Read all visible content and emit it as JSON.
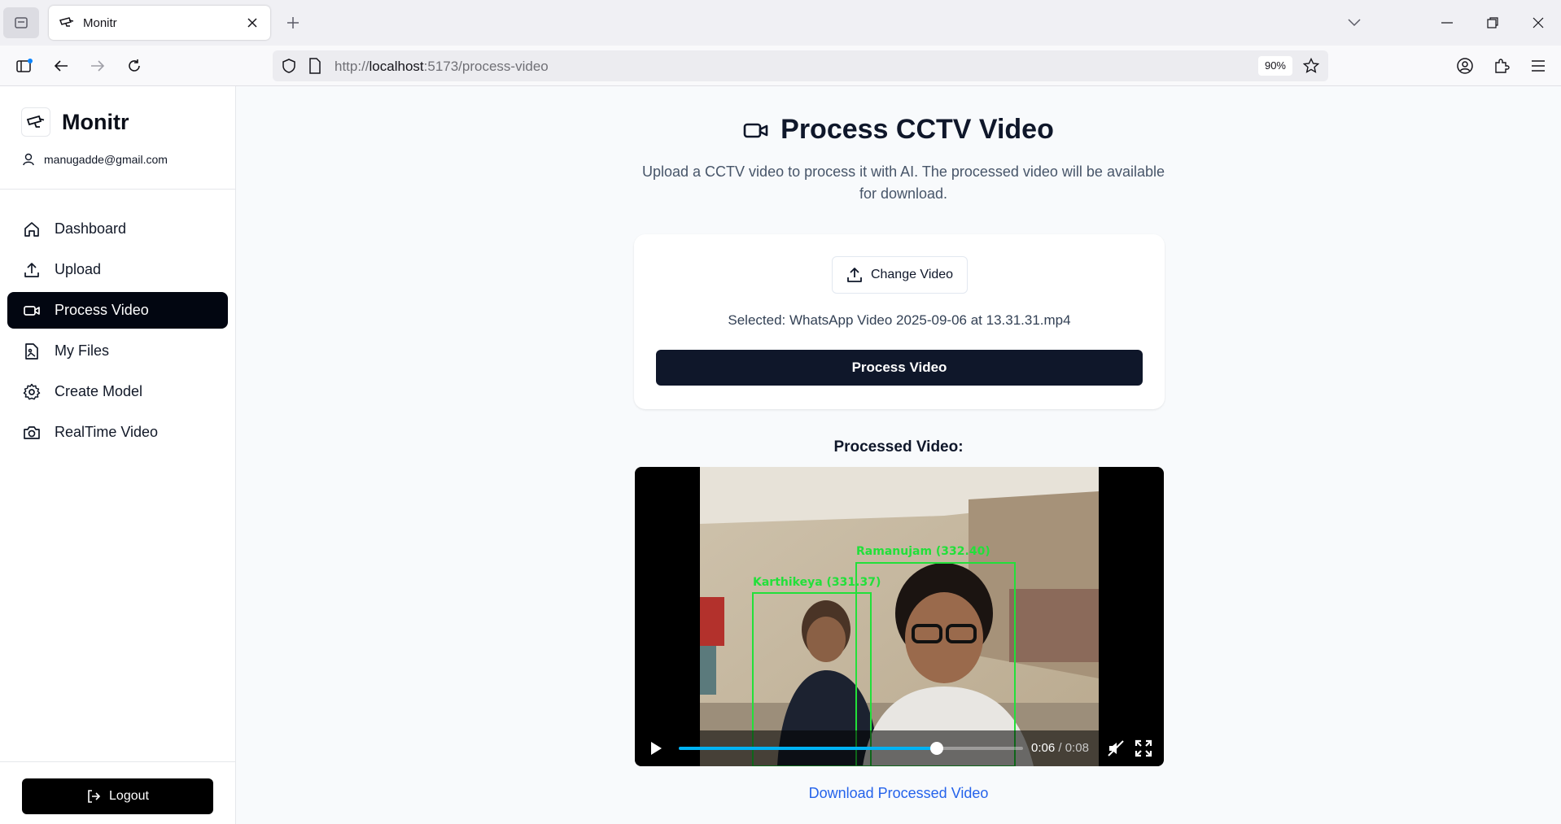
{
  "browser": {
    "tab_title": "Monitr",
    "url_scheme": "http://",
    "url_host": "localhost",
    "url_rest": ":5173/process-video",
    "zoom": "90%"
  },
  "sidebar": {
    "brand": "Monitr",
    "user_email": "manugadde@gmail.com",
    "items": [
      {
        "label": "Dashboard",
        "icon": "home-icon"
      },
      {
        "label": "Upload",
        "icon": "upload-icon"
      },
      {
        "label": "Process Video",
        "icon": "video-camera-icon",
        "active": true
      },
      {
        "label": "My Files",
        "icon": "file-image-icon"
      },
      {
        "label": "Create Model",
        "icon": "gear-icon"
      },
      {
        "label": "RealTime Video",
        "icon": "camera-icon"
      }
    ],
    "logout_label": "Logout"
  },
  "main": {
    "title": "Process CCTV Video",
    "description": "Upload a CCTV video to process it with AI. The processed video will be available for download.",
    "change_video_label": "Change Video",
    "selected_text": "Selected: WhatsApp Video 2025-09-06 at 13.31.31.mp4",
    "process_button_label": "Process Video",
    "processed_label": "Processed Video:",
    "video": {
      "current_time": "0:06",
      "separator": " / ",
      "duration": "0:08",
      "progress_fraction": 0.75,
      "detections": [
        {
          "label": "Karthikeya (331.37)"
        },
        {
          "label": "Ramanujam (332.40)"
        }
      ],
      "detection_color": "#22e03a",
      "progress_color": "#00b3f4"
    },
    "download_label": "Download Processed Video"
  },
  "colors": {
    "active_bg": "#020611",
    "primary_btn": "#0f172a",
    "link": "#2563eb"
  }
}
